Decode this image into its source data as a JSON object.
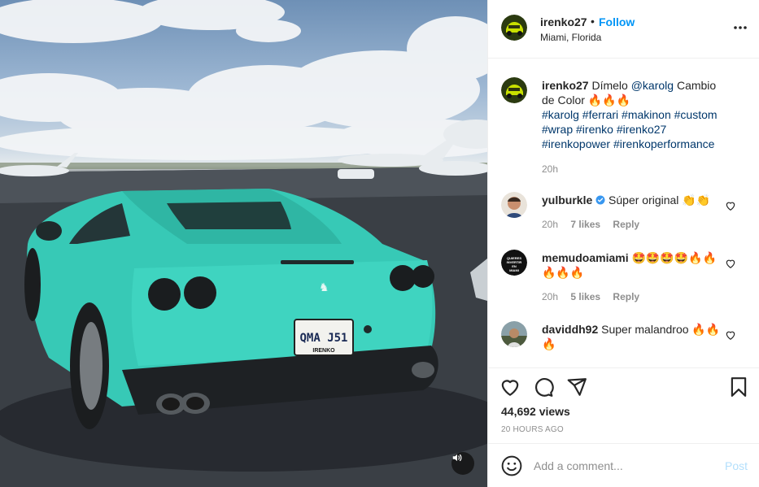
{
  "post": {
    "username": "irenko27",
    "separator": "•",
    "follow_label": "Follow",
    "location": "Miami, Florida"
  },
  "caption": {
    "username": "irenko27",
    "text_before": "Dímelo ",
    "mention": "@karolg",
    "text_after": " Cambio de Color 🔥🔥🔥",
    "hashtags": "#karolg #ferrari #makinon #custom #wrap #irenko #irenko27 #irenkopower #irenkoperformance",
    "time": "20h"
  },
  "comments": [
    {
      "username": "yulburkle",
      "verified": true,
      "text": "Súper original 👏👏",
      "time": "20h",
      "likes": "7 likes",
      "reply": "Reply"
    },
    {
      "username": "memudoamiami",
      "verified": false,
      "text": "🤩🤩🤩🤩🔥🔥🔥🔥🔥",
      "time": "20h",
      "likes": "5 likes",
      "reply": "Reply",
      "avatar_text": "QUIERES INVERTIR EN MIAMI"
    },
    {
      "username": "daviddh92",
      "verified": false,
      "text": "Super malandroo 🔥🔥🔥"
    }
  ],
  "stats": {
    "views": "44,692 views",
    "posted": "20 HOURS AGO"
  },
  "add_comment": {
    "placeholder": "Add a comment...",
    "post_label": "Post"
  },
  "photo": {
    "plate": "QMA J51",
    "plate_footer": "IRENKO"
  },
  "icons": {
    "more": "more-options-icon",
    "like": "heart-icon",
    "comment": "comment-bubble-icon",
    "share": "paper-plane-icon",
    "save": "bookmark-icon",
    "emoji": "smiley-icon",
    "sound": "speaker-icon",
    "verified": "verified-badge-icon"
  },
  "colors": {
    "link_blue": "#0095f6",
    "post_disabled": "#b2dffc",
    "car": "#37c9b6"
  }
}
